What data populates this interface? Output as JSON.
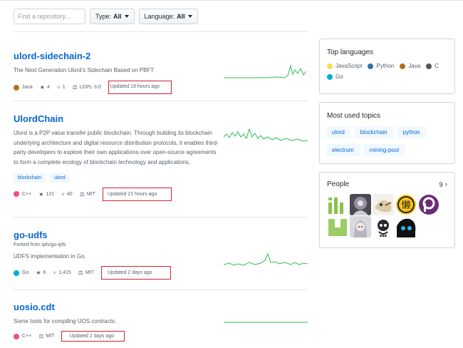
{
  "filters": {
    "search_placeholder": "Find a repository...",
    "type_label": "Type:",
    "type_value": "All",
    "language_label": "Language:",
    "language_value": "All"
  },
  "repos": [
    {
      "name": "ulord-sidechain-2",
      "description": "The Next Generation Ulord's Sidechain Based on PBFT",
      "language": "Java",
      "language_color": "#b07219",
      "stars": "4",
      "forks": "1",
      "license": "LGPL-3.0",
      "updated": "Updated 19 hours ago"
    },
    {
      "name": "UlordChain",
      "description": "Ulord is a P2P value transfer public blockchain. Through building its blockchain underlying architecture and digital resource distribution protocols, it enables third-party developers to explore their own applications over open-source agreements to form a complete ecology of blockchain technology and applications.",
      "topics": [
        "blockchain",
        "ulord"
      ],
      "language": "C++",
      "language_color": "#f34b7d",
      "stars": "131",
      "forks": "40",
      "license": "MIT",
      "updated": "Updated 21 hours ago"
    },
    {
      "name": "go-udfs",
      "forked_from": "Forked from ipfs/go-ipfs",
      "description": "UDFS implementation in Go.",
      "language": "Go",
      "language_color": "#00add8",
      "stars": "6",
      "forks": "1,415",
      "license": "MIT",
      "updated": "Updated 2 days ago"
    },
    {
      "name": "uosio.cdt",
      "description": "Some tools for compiling UOS contracts.",
      "language": "C++",
      "language_color": "#f34b7d",
      "license": "MIT",
      "updated": "Updated 2 days ago"
    }
  ],
  "sidebar": {
    "top_languages_title": "Top languages",
    "languages": [
      {
        "name": "JavaScript",
        "color": "#f1e05a"
      },
      {
        "name": "Python",
        "color": "#3572a5"
      },
      {
        "name": "Java",
        "color": "#b07219"
      },
      {
        "name": "C",
        "color": "#555555"
      },
      {
        "name": "Go",
        "color": "#00add8"
      }
    ],
    "topics_title": "Most used topics",
    "topics": [
      "ulord",
      "blockchain",
      "python",
      "electrum",
      "mining-pool"
    ],
    "people_title": "People",
    "people_count": "9"
  },
  "colors": {
    "link": "#0366d6",
    "highlight_border": "#cb2431",
    "sparkline": "#2cbe4e"
  }
}
